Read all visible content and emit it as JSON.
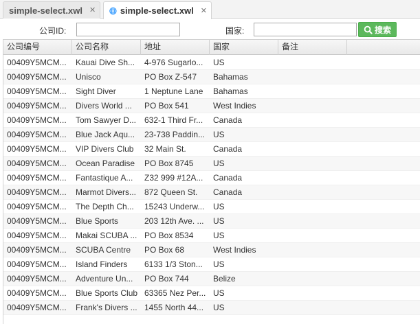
{
  "tabs": [
    {
      "label": "simple-select.xwl",
      "active": false
    },
    {
      "label": "simple-select.xwl",
      "active": true
    }
  ],
  "search": {
    "company_id_label": "公司ID:",
    "company_id_value": "",
    "country_label": "国家:",
    "country_value": "",
    "button_label": "搜索"
  },
  "colors": {
    "button_bg": "#5cb85c",
    "globe": "#1e90ff"
  },
  "grid": {
    "columns": [
      "公司编号",
      "公司名称",
      "地址",
      "国家",
      "备注"
    ],
    "rows": [
      [
        "00409Y5MCM...",
        "Kauai Dive Sh...",
        "4-976 Sugarlo...",
        "US",
        ""
      ],
      [
        "00409Y5MCM...",
        "Unisco",
        "PO Box Z-547",
        "Bahamas",
        ""
      ],
      [
        "00409Y5MCM...",
        "Sight Diver",
        "1 Neptune Lane",
        "Bahamas",
        ""
      ],
      [
        "00409Y5MCM...",
        "Divers World ...",
        "PO Box 541",
        "West Indies",
        ""
      ],
      [
        "00409Y5MCM...",
        "Tom Sawyer D...",
        "632-1 Third Fr...",
        "Canada",
        ""
      ],
      [
        "00409Y5MCM...",
        "Blue Jack Aqu...",
        "23-738 Paddin...",
        "US",
        ""
      ],
      [
        "00409Y5MCM...",
        "VIP Divers Club",
        "32 Main St.",
        "Canada",
        ""
      ],
      [
        "00409Y5MCM...",
        "Ocean Paradise",
        "PO Box 8745",
        "US",
        ""
      ],
      [
        "00409Y5MCM...",
        "Fantastique A...",
        "Z32 999 #12A...",
        "Canada",
        ""
      ],
      [
        "00409Y5MCM...",
        "Marmot Divers...",
        "872 Queen St.",
        "Canada",
        ""
      ],
      [
        "00409Y5MCM...",
        "The Depth Ch...",
        "15243 Underw...",
        "US",
        ""
      ],
      [
        "00409Y5MCM...",
        "Blue Sports",
        "203 12th Ave. ...",
        "US",
        ""
      ],
      [
        "00409Y5MCM...",
        "Makai SCUBA ...",
        "PO Box 8534",
        "US",
        ""
      ],
      [
        "00409Y5MCM...",
        "SCUBA Centre",
        "PO Box 68",
        "West Indies",
        ""
      ],
      [
        "00409Y5MCM...",
        "Island Finders",
        "6133 1/3 Ston...",
        "US",
        ""
      ],
      [
        "00409Y5MCM...",
        "Adventure Un...",
        "PO Box 744",
        "Belize",
        ""
      ],
      [
        "00409Y5MCM...",
        "Blue Sports Club",
        "63365 Nez Per...",
        "US",
        ""
      ],
      [
        "00409Y5MCM...",
        "Frank's Divers ...",
        "1455 North 44...",
        "US",
        ""
      ]
    ]
  }
}
